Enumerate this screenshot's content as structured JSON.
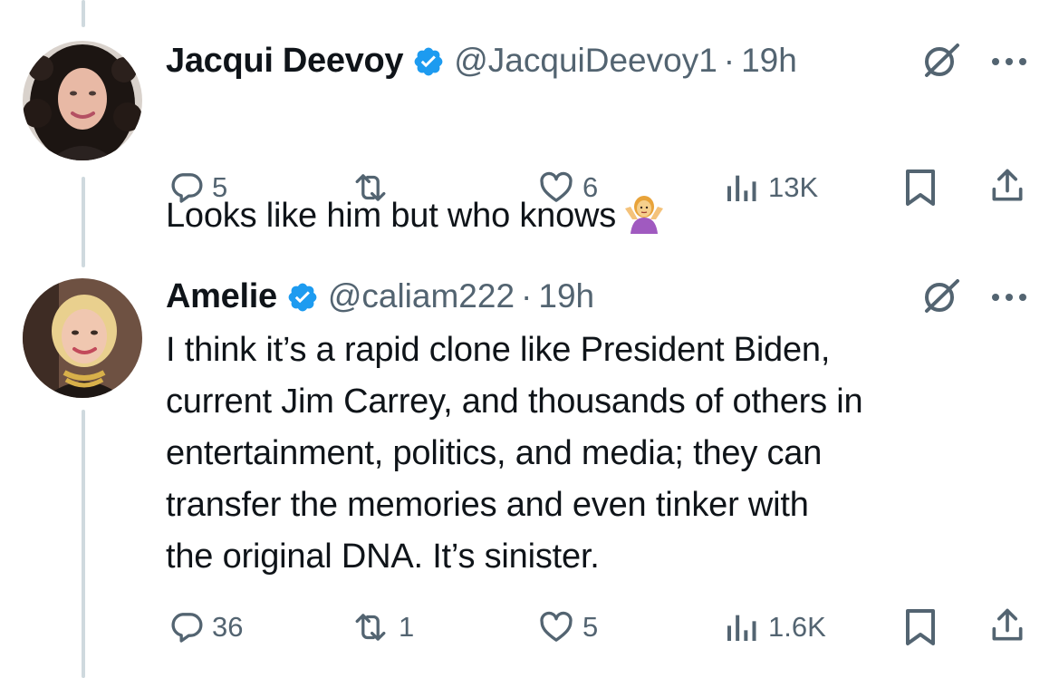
{
  "tweets": [
    {
      "name": "Jacqui Deevoy",
      "verified": true,
      "handle": "@JacquiDeevoy1",
      "separator": "·",
      "time": "19h",
      "text": "Looks like him but who knows",
      "emoji": "person-shrugging-emoji",
      "replies": "5",
      "reposts": "",
      "likes": "6",
      "views": "13K"
    },
    {
      "name": "Amelie",
      "verified": true,
      "handle": "@caliam222",
      "separator": "·",
      "time": "19h",
      "text": "I think it’s a rapid clone like President Biden,\ncurrent Jim Carrey, and thousands of others in\nentertainment, politics, and media; they can\ntransfer the memories and even tinker with\nthe original DNA.  It’s sinister.",
      "replies": "36",
      "reposts": "1",
      "likes": "5",
      "views": "1.6K"
    }
  ],
  "icons": {
    "verified": "verified-badge-icon",
    "grok": "grok-icon",
    "more": "more-options-icon",
    "reply": "reply-icon",
    "repost": "repost-icon",
    "like": "like-icon",
    "views": "views-icon",
    "bookmark": "bookmark-icon",
    "share": "share-icon"
  },
  "colors": {
    "text": "#0f1419",
    "secondary": "#536471",
    "verified": "#1d9bf0",
    "thread_line": "#cfd9de"
  }
}
